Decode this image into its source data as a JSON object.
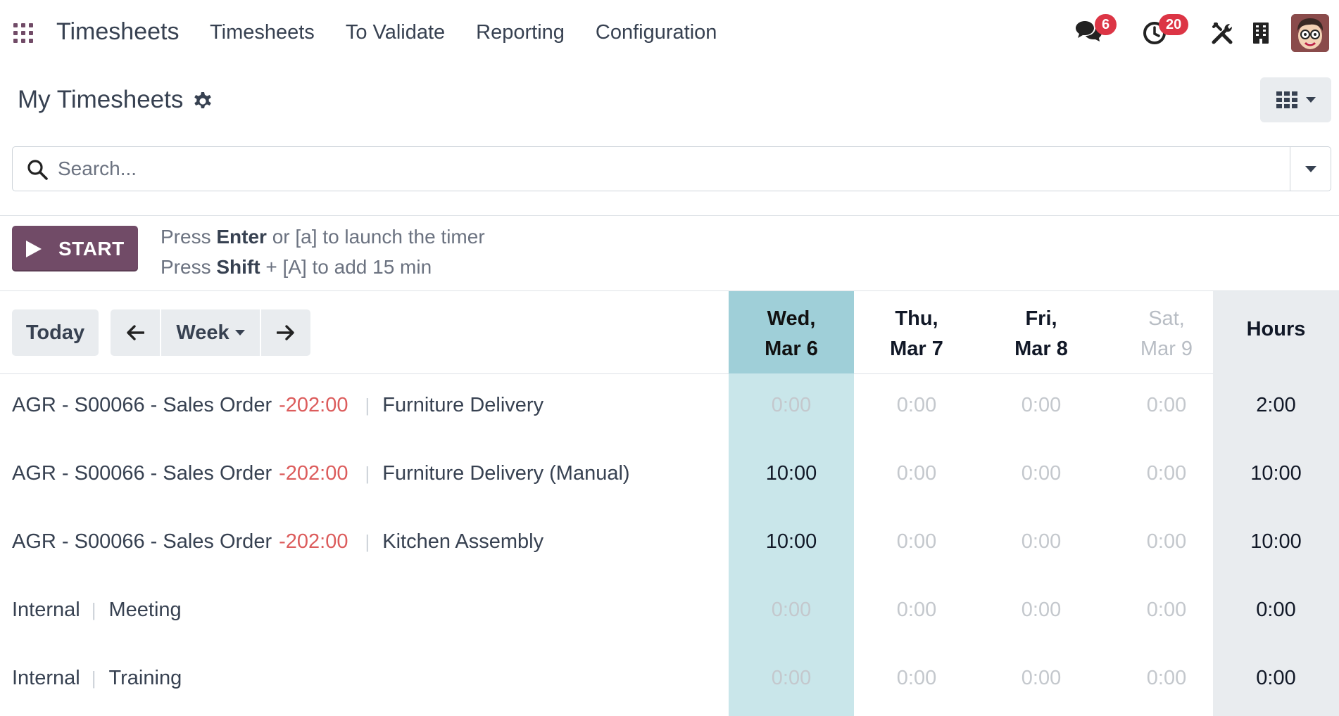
{
  "navbar": {
    "brand": "Timesheets",
    "menu": [
      {
        "label": "Timesheets"
      },
      {
        "label": "To Validate"
      },
      {
        "label": "Reporting"
      },
      {
        "label": "Configuration"
      }
    ],
    "messages_badge": "6",
    "activities_badge": "20"
  },
  "control_panel": {
    "title": "My Timesheets",
    "search_placeholder": "Search..."
  },
  "timer": {
    "start_label": "START",
    "help_line1": {
      "pre": "Press ",
      "key": "Enter",
      "post": " or [a] to launch the timer"
    },
    "help_line2": {
      "pre": "Press ",
      "key": "Shift",
      "post": " + [A] to add 15 min"
    }
  },
  "grid": {
    "range": {
      "today": "Today",
      "period": "Week"
    },
    "columns": [
      {
        "line1": "Wed,",
        "line2": "Mar 6"
      },
      {
        "line1": "Thu,",
        "line2": "Mar 7"
      },
      {
        "line1": "Fri,",
        "line2": "Mar 8"
      },
      {
        "line1": "Sat,",
        "line2": "Mar 9"
      }
    ],
    "total_header": "Hours",
    "rows": [
      {
        "project": "AGR - S00066 - Sales Order",
        "remaining": "-202:00",
        "task": "Furniture Delivery",
        "cells": [
          "0:00",
          "0:00",
          "0:00",
          "0:00"
        ],
        "total": "2:00"
      },
      {
        "project": "AGR - S00066 - Sales Order",
        "remaining": "-202:00",
        "task": "Furniture Delivery (Manual)",
        "cells": [
          "10:00",
          "0:00",
          "0:00",
          "0:00"
        ],
        "total": "10:00"
      },
      {
        "project": "AGR - S00066 - Sales Order",
        "remaining": "-202:00",
        "task": "Kitchen Assembly",
        "cells": [
          "10:00",
          "0:00",
          "0:00",
          "0:00"
        ],
        "total": "10:00"
      },
      {
        "project": "Internal",
        "remaining": "",
        "task": "Meeting",
        "cells": [
          "0:00",
          "0:00",
          "0:00",
          "0:00"
        ],
        "total": "0:00"
      },
      {
        "project": "Internal",
        "remaining": "",
        "task": "Training",
        "cells": [
          "0:00",
          "0:00",
          "0:00",
          "0:00"
        ],
        "total": "0:00"
      }
    ]
  },
  "colors": {
    "primary": "#714b67",
    "today_column": "#c9e6ea",
    "today_header": "#9fcfd8",
    "negative": "#dc5c5c",
    "badge": "#dc3545"
  }
}
